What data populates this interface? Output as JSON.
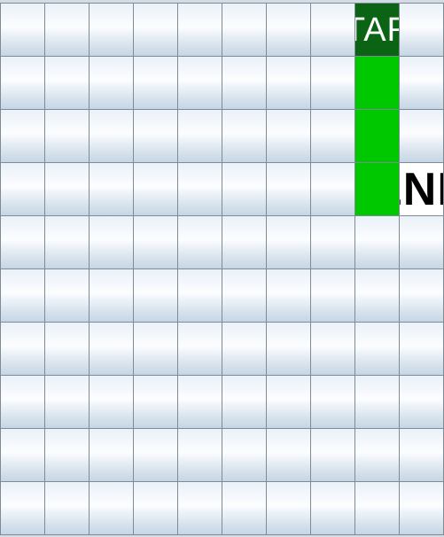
{
  "board": {
    "rows": 10,
    "cols": 10,
    "start_label": "START",
    "end_label": "END",
    "start_cell": {
      "row": 0,
      "col": 8
    },
    "end_cell": {
      "row": 3,
      "col": 9
    },
    "path_cells": [
      {
        "row": 1,
        "col": 8
      },
      {
        "row": 2,
        "col": 8
      },
      {
        "row": 3,
        "col": 8
      }
    ],
    "colors": {
      "start": "#0a6414",
      "path": "#00c800",
      "end": "#ffffff",
      "border": "#7f8b94"
    }
  }
}
